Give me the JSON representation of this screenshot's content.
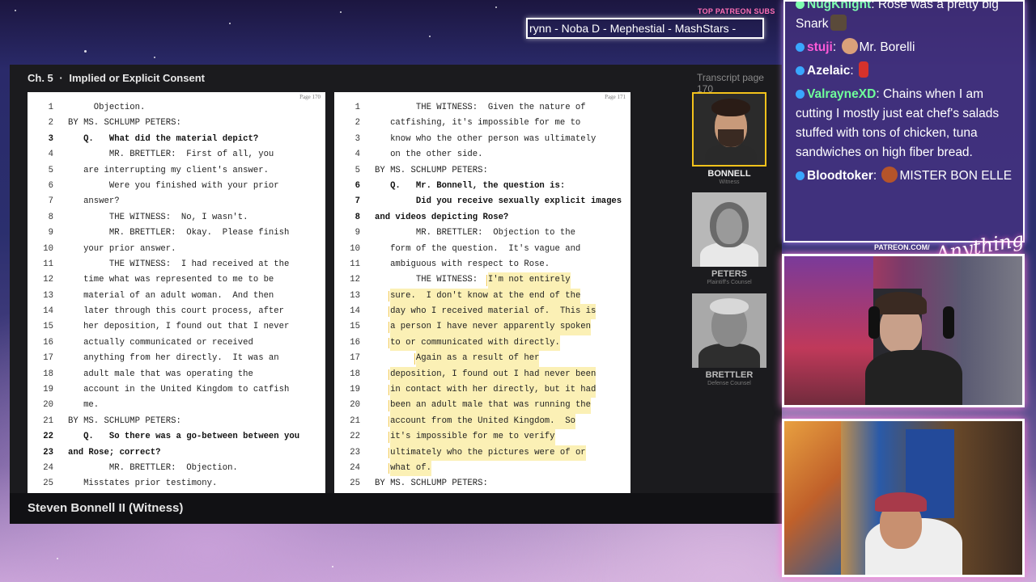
{
  "patreon": {
    "label": "TOP PATREON SUBS",
    "names": "rynn -  Noba D - Mephestial - MashStars -"
  },
  "chapter": {
    "number": "Ch. 5",
    "separator": "·",
    "title": "Implied or Explicit Consent"
  },
  "transcript_page_label": "Transcript page 170",
  "left_page": {
    "tag": "Page 170",
    "lines": [
      {
        "n": "1",
        "text": "     Objection."
      },
      {
        "n": "2",
        "text": "BY MS. SCHLUMP PETERS:"
      },
      {
        "n": "3",
        "text": "   Q.   What did the material depict?",
        "bold": true
      },
      {
        "n": "4",
        "text": "        MR. BRETTLER:  First of all, you"
      },
      {
        "n": "5",
        "text": "   are interrupting my client's answer."
      },
      {
        "n": "6",
        "text": "        Were you finished with your prior"
      },
      {
        "n": "7",
        "text": "   answer?"
      },
      {
        "n": "8",
        "text": "        THE WITNESS:  No, I wasn't."
      },
      {
        "n": "9",
        "text": "        MR. BRETTLER:  Okay.  Please finish"
      },
      {
        "n": "10",
        "text": "   your prior answer."
      },
      {
        "n": "11",
        "text": "        THE WITNESS:  I had received at the"
      },
      {
        "n": "12",
        "text": "   time what was represented to me to be"
      },
      {
        "n": "13",
        "text": "   material of an adult woman.  And then"
      },
      {
        "n": "14",
        "text": "   later through this court process, after"
      },
      {
        "n": "15",
        "text": "   her deposition, I found out that I never"
      },
      {
        "n": "16",
        "text": "   actually communicated or received"
      },
      {
        "n": "17",
        "text": "   anything from her directly.  It was an"
      },
      {
        "n": "18",
        "text": "   adult male that was operating the"
      },
      {
        "n": "19",
        "text": "   account in the United Kingdom to catfish"
      },
      {
        "n": "20",
        "text": "   me."
      },
      {
        "n": "21",
        "text": "BY MS. SCHLUMP PETERS:"
      },
      {
        "n": "22",
        "text": "   Q.   So there was a go-between between you",
        "bold": true
      },
      {
        "n": "23",
        "text": "and Rose; correct?",
        "bold": true
      },
      {
        "n": "24",
        "text": "        MR. BRETTLER:  Objection."
      },
      {
        "n": "25",
        "text": "   Misstates prior testimony."
      }
    ]
  },
  "right_page": {
    "tag": "Page 171",
    "lines": [
      {
        "n": "1",
        "text": "        THE WITNESS:  Given the nature of"
      },
      {
        "n": "2",
        "text": "   catfishing, it's impossible for me to"
      },
      {
        "n": "3",
        "text": "   know who the other person was ultimately"
      },
      {
        "n": "4",
        "text": "   on the other side."
      },
      {
        "n": "5",
        "text": "BY MS. SCHLUMP PETERS:"
      },
      {
        "n": "6",
        "text": "   Q.   Mr. Bonnell, the question is:",
        "bold": true
      },
      {
        "n": "7",
        "text": "        Did you receive sexually explicit images",
        "bold": true
      },
      {
        "n": "8",
        "text": "and videos depicting Rose?",
        "bold": true
      },
      {
        "n": "9",
        "text": "        MR. BRETTLER:  Objection to the"
      },
      {
        "n": "10",
        "text": "   form of the question.  It's vague and"
      },
      {
        "n": "11",
        "text": "   ambiguous with respect to Rose."
      },
      {
        "n": "12",
        "text": "        THE WITNESS:  ",
        "hl": "I'm not entirely"
      },
      {
        "n": "13",
        "text": "   ",
        "hl": "sure.  I don't know at the end of the"
      },
      {
        "n": "14",
        "text": "   ",
        "hl": "day who I received material of.  This is"
      },
      {
        "n": "15",
        "text": "   ",
        "hl": "a person I have never apparently spoken"
      },
      {
        "n": "16",
        "text": "   ",
        "hl": "to or communicated with directly."
      },
      {
        "n": "17",
        "text": "        ",
        "hl": "Again as a result of her"
      },
      {
        "n": "18",
        "text": "   ",
        "hl": "deposition, I found out I had never been"
      },
      {
        "n": "19",
        "text": "   ",
        "hl": "in contact with her directly, but it had"
      },
      {
        "n": "20",
        "text": "   ",
        "hl": "been an adult male that was running the"
      },
      {
        "n": "21",
        "text": "   ",
        "hl": "account from the United Kingdom.  So"
      },
      {
        "n": "22",
        "text": "   ",
        "hl": "it's impossible for me to verify"
      },
      {
        "n": "23",
        "text": "   ",
        "hl": "ultimately who the pictures were of or"
      },
      {
        "n": "24",
        "text": "   ",
        "hl": "what of."
      },
      {
        "n": "25",
        "text": "BY MS. SCHLUMP PETERS:"
      }
    ]
  },
  "witness_label": "Steven Bonnell II (Witness)",
  "people": [
    {
      "name": "BONNELL",
      "role": "Witness",
      "active": true
    },
    {
      "name": "PETERS",
      "role": "Plaintiff's Counsel",
      "active": false
    },
    {
      "name": "BRETTLER",
      "role": "Defense Counsel",
      "active": false
    }
  ],
  "chat": [
    {
      "user": "NugKnight",
      "user_color": "#7fffb0",
      "text": "Rose was a pretty big Snark",
      "emote": "#5a4a3a"
    },
    {
      "user": "stuji",
      "user_color": "#ff5ad8",
      "text": "Mr. Borelli",
      "emote_before": "#d9a07a"
    },
    {
      "user": "Azelaic",
      "user_color": "#ffffff",
      "text": "",
      "emote": "#d6322b"
    },
    {
      "user": "ValrayneXD",
      "user_color": "#6fff9a",
      "text": "Chains when I am cutting I mostly just eat chef's salads stuffed with tons of chicken, tuna sandwiches on high fiber bread."
    },
    {
      "user": "Bloodtoker",
      "user_color": "#ffffff",
      "text": "MISTER BON ELLE",
      "emote_before": "#b5542a"
    }
  ],
  "overlay": {
    "patreon_url": "PATREON.COM/",
    "logo": "Anything Else?"
  },
  "colors": {
    "panel_bg": "#1b1b1e",
    "highlight": "#fbf0b5",
    "active_border": "#f3c21b",
    "chat_bg": "#46328a"
  }
}
